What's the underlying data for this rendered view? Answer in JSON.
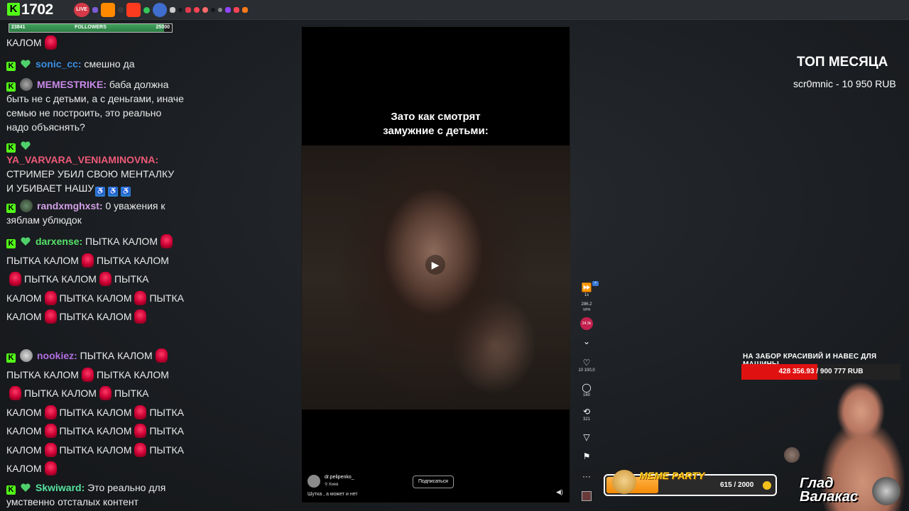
{
  "topbar": {
    "viewer_count": "1702",
    "live_label": "LIVE",
    "ext_colors": [
      "#e0a62a",
      "#7b5cd6",
      "#ff8a00",
      "#3a3a3a",
      "#ff3b1f",
      "#35c759",
      "#16181c",
      "#3f6ecf",
      "#7f3fe0",
      "#e23b4e",
      "#ff6b00",
      "#c22",
      "#ffffff",
      "#9146ff",
      "#ff4455",
      "#ff7a1a"
    ]
  },
  "followers": {
    "current": "23841",
    "label": "FOLLOWERS",
    "goal": "25000",
    "progress": 0.9536
  },
  "chat": {
    "messages": [
      {
        "text_start": "КАЛОМ"
      },
      {
        "nick": "sonic_cc:",
        "nick_color": "#3c8de3",
        "text": "смешно да"
      },
      {
        "nick": "MEMESTRIKE:",
        "nick_color": "#c98ae8",
        "text": "баба должна быть не с детьми, а с деньгами, иначе семью не построить, это реально надо объяснять?"
      },
      {
        "nick": "YA_VARVARA_VENIAMINOVNA:",
        "nick_color": "#ee5a78",
        "text": "СТРИМЕР УБИЛ СВОЮ МЕНТАЛКУ И УБИВАЕТ НАШУ"
      },
      {
        "nick": "randxmghxst:",
        "nick_color": "#d1a0e6",
        "text": "0 уважения к зяблам ублюдок"
      },
      {
        "nick": "darxense:",
        "nick_color": "#56e36b",
        "text_parts": [
          "ПЫТКА КАЛОМ",
          "ПЫТКА КАЛОМ",
          "ПЫТКА КАЛОМ",
          "ПЫТКА КАЛОМ",
          "ПЫТКА КАЛОМ",
          "ПЫТКА КАЛОМ",
          "ПЫТКА КАЛОМ",
          "ПЫТКА КАЛОМ"
        ]
      },
      {
        "nick": "nookiez:",
        "nick_color": "#b06ee0",
        "text_parts": [
          "ПЫТКА КАЛОМ",
          "ПЫТКА КАЛОМ",
          "ПЫТКА КАЛОМ",
          "ПЫТКА КАЛОМ",
          "ПЫТКА КАЛОМ",
          "ПЫТКА КАЛОМ",
          "ПЫТКА КАЛОМ",
          "ПЫТКА КАЛОМ",
          "ПЫТКА КАЛОМ",
          "ПЫТКА КАЛОМ",
          "ПЫТКА КАЛОМ"
        ]
      },
      {
        "nick": "Skwiward:",
        "nick_color": "#56e3a0",
        "text": "Это реально для умственно отсталых контент"
      }
    ]
  },
  "video": {
    "caption_line1": "Зато как смотрят",
    "caption_line2": "замужние с детьми:",
    "author": "dr.pelipenko_",
    "location": "Киев",
    "description": "Шутка , а может и нет",
    "subscribe": "Подписаться"
  },
  "side_controls": {
    "speed": "1x",
    "vph": "286.2",
    "vph_label": "VPH",
    "trend": "24.3k",
    "likes": "10 100,0",
    "comments": "160",
    "reposts": "321",
    "more": "···"
  },
  "right": {
    "top_month_title": "ТОП МЕСЯЦА",
    "top_donor": "scr0mnic - 10 950 RUB",
    "goal_title": "НА ЗАБОР КРАСИВИЙ И НАВЕС ДЛЯ МАШИНЫ",
    "goal_progress": "428 356.93 / 900 777 RUB",
    "goal_fraction": 0.4755,
    "meme_title": "MEME PARTY",
    "meme_count": "615 / 2000",
    "meme_fraction": 0.3075,
    "streamer_name_line1": "Глад",
    "streamer_name_line2": "Валакас"
  }
}
